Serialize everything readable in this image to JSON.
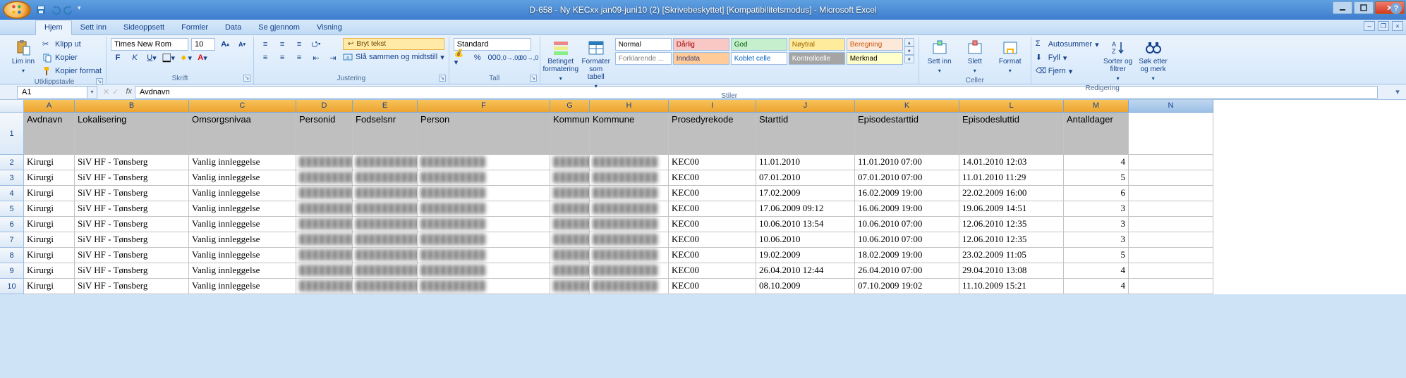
{
  "title": "D-658 - Ny KECxx jan09-juni10 (2)  [Skrivebeskyttet]  [Kompatibilitetsmodus] - Microsoft Excel",
  "tabs": [
    "Hjem",
    "Sett inn",
    "Sideoppsett",
    "Formler",
    "Data",
    "Se gjennom",
    "Visning"
  ],
  "activeTab": 0,
  "clipboard": {
    "label": "Utklippstavle",
    "paste": "Lim inn",
    "cut": "Klipp ut",
    "copy": "Kopier",
    "fmtpaint": "Kopier format"
  },
  "font": {
    "label": "Skrift",
    "name": "Times New Rom",
    "size": "10"
  },
  "align": {
    "label": "Justering",
    "wrap": "Bryt tekst",
    "merge": "Slå sammen og midtstill"
  },
  "number": {
    "label": "Tall",
    "fmt": "Standard"
  },
  "tables": {
    "cond": "Betinget formatering",
    "astable": "Formater som tabell"
  },
  "styles": {
    "label": "Stiler",
    "items": [
      {
        "t": "Normal",
        "bg": "#ffffff",
        "c": "#000"
      },
      {
        "t": "Dårlig",
        "bg": "#f9c7c4",
        "c": "#9c0006"
      },
      {
        "t": "God",
        "bg": "#c6efce",
        "c": "#006100"
      },
      {
        "t": "Nøytral",
        "bg": "#ffeb9c",
        "c": "#9c6500"
      },
      {
        "t": "Beregning",
        "bg": "#fde9d9",
        "c": "#c65911"
      },
      {
        "t": "Forklarende ...",
        "bg": "#ffffff",
        "c": "#7f7f7f"
      },
      {
        "t": "Inndata",
        "bg": "#ffcc99",
        "c": "#3f3f76"
      },
      {
        "t": "Koblet celle",
        "bg": "#ffffff",
        "c": "#0563c1"
      },
      {
        "t": "Kontrollcelle",
        "bg": "#a5a5a5",
        "c": "#ffffff"
      },
      {
        "t": "Merknad",
        "bg": "#ffffcc",
        "c": "#000"
      }
    ]
  },
  "cells": {
    "label": "Celler",
    "insert": "Sett inn",
    "delete": "Slett",
    "format": "Format"
  },
  "editing": {
    "label": "Redigering",
    "autosum": "Autosummer",
    "fill": "Fyll",
    "clear": "Fjern",
    "sort": "Sorter og filtrer",
    "find": "Søk etter og merk"
  },
  "namebox": "A1",
  "formula": "Avdnavn",
  "columns": [
    "A",
    "B",
    "C",
    "D",
    "E",
    "F",
    "G",
    "H",
    "I",
    "J",
    "K",
    "L",
    "M",
    "N"
  ],
  "headers": [
    "Avdnavn",
    "Lokalisering",
    "Omsorgsnivaa",
    "Personid",
    "Fodselsnr",
    "Person",
    "Kommunenr",
    "Kommune",
    "Prosedyrekode",
    "Starttid",
    "Episodestarttid",
    "Episodesluttid",
    "Antalldager",
    ""
  ],
  "rows": [
    {
      "n": 2,
      "A": "Kirurgi",
      "B": "SiV HF - Tønsberg",
      "C": "Vanlig innleggelse",
      "I": "KEC00",
      "J": "11.01.2010",
      "K": "11.01.2010 07:00",
      "L": "14.01.2010 12:03",
      "M": "4"
    },
    {
      "n": 3,
      "A": "Kirurgi",
      "B": "SiV HF - Tønsberg",
      "C": "Vanlig innleggelse",
      "I": "KEC00",
      "J": "07.01.2010",
      "K": "07.01.2010 07:00",
      "L": "11.01.2010 11:29",
      "M": "5"
    },
    {
      "n": 4,
      "A": "Kirurgi",
      "B": "SiV HF - Tønsberg",
      "C": "Vanlig innleggelse",
      "I": "KEC00",
      "J": "17.02.2009",
      "K": "16.02.2009 19:00",
      "L": "22.02.2009 16:00",
      "M": "6"
    },
    {
      "n": 5,
      "A": "Kirurgi",
      "B": "SiV HF - Tønsberg",
      "C": "Vanlig innleggelse",
      "I": "KEC00",
      "J": "17.06.2009 09:12",
      "K": "16.06.2009 19:00",
      "L": "19.06.2009 14:51",
      "M": "3"
    },
    {
      "n": 6,
      "A": "Kirurgi",
      "B": "SiV HF - Tønsberg",
      "C": "Vanlig innleggelse",
      "I": "KEC00",
      "J": "10.06.2010 13:54",
      "K": "10.06.2010 07:00",
      "L": "12.06.2010 12:35",
      "M": "3"
    },
    {
      "n": 7,
      "A": "Kirurgi",
      "B": "SiV HF - Tønsberg",
      "C": "Vanlig innleggelse",
      "I": "KEC00",
      "J": "10.06.2010",
      "K": "10.06.2010 07:00",
      "L": "12.06.2010 12:35",
      "M": "3"
    },
    {
      "n": 8,
      "A": "Kirurgi",
      "B": "SiV HF - Tønsberg",
      "C": "Vanlig innleggelse",
      "I": "KEC00",
      "J": "19.02.2009",
      "K": "18.02.2009 19:00",
      "L": "23.02.2009 11:05",
      "M": "5"
    },
    {
      "n": 9,
      "A": "Kirurgi",
      "B": "SiV HF - Tønsberg",
      "C": "Vanlig innleggelse",
      "I": "KEC00",
      "J": "26.04.2010 12:44",
      "K": "26.04.2010 07:00",
      "L": "29.04.2010 13:08",
      "M": "4"
    },
    {
      "n": 10,
      "A": "Kirurgi",
      "B": "SiV HF - Tønsberg",
      "C": "Vanlig innleggelse",
      "I": "KEC00",
      "J": "08.10.2009",
      "K": "07.10.2009 19:02",
      "L": "11.10.2009 15:21",
      "M": "4"
    }
  ],
  "blurtext": "██████████"
}
